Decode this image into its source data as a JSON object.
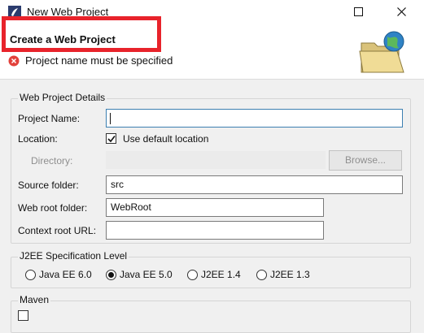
{
  "window": {
    "title": "New Web Project",
    "maximize_icon": "maximize-icon",
    "close_icon": "close-icon"
  },
  "header": {
    "title": "Create a Web Project",
    "error_message": "Project name must be specified",
    "error_icon": "error-icon",
    "graphic": "folder-globe-icon"
  },
  "colors": {
    "highlight": "#e8232b",
    "error": "#e2413b",
    "focus": "#3c7fb1"
  },
  "details": {
    "legend": "Web Project Details",
    "project_name": {
      "label": "Project Name:",
      "value": ""
    },
    "location": {
      "label": "Location:",
      "checkbox_label": "Use default location",
      "checked": true
    },
    "directory": {
      "label": "Directory:",
      "browse_label": "Browse..."
    },
    "source_folder": {
      "label": "Source folder:",
      "value": "src"
    },
    "web_root": {
      "label": "Web root folder:",
      "value": "WebRoot"
    },
    "context_root": {
      "label": "Context root URL:",
      "value": ""
    }
  },
  "j2ee": {
    "legend": "J2EE Specification Level",
    "options": [
      {
        "label": "Java EE 6.0",
        "selected": false
      },
      {
        "label": "Java EE 5.0",
        "selected": true
      },
      {
        "label": "J2EE 1.4",
        "selected": false
      },
      {
        "label": "J2EE 1.3",
        "selected": false
      }
    ]
  },
  "maven": {
    "legend": "Maven"
  }
}
